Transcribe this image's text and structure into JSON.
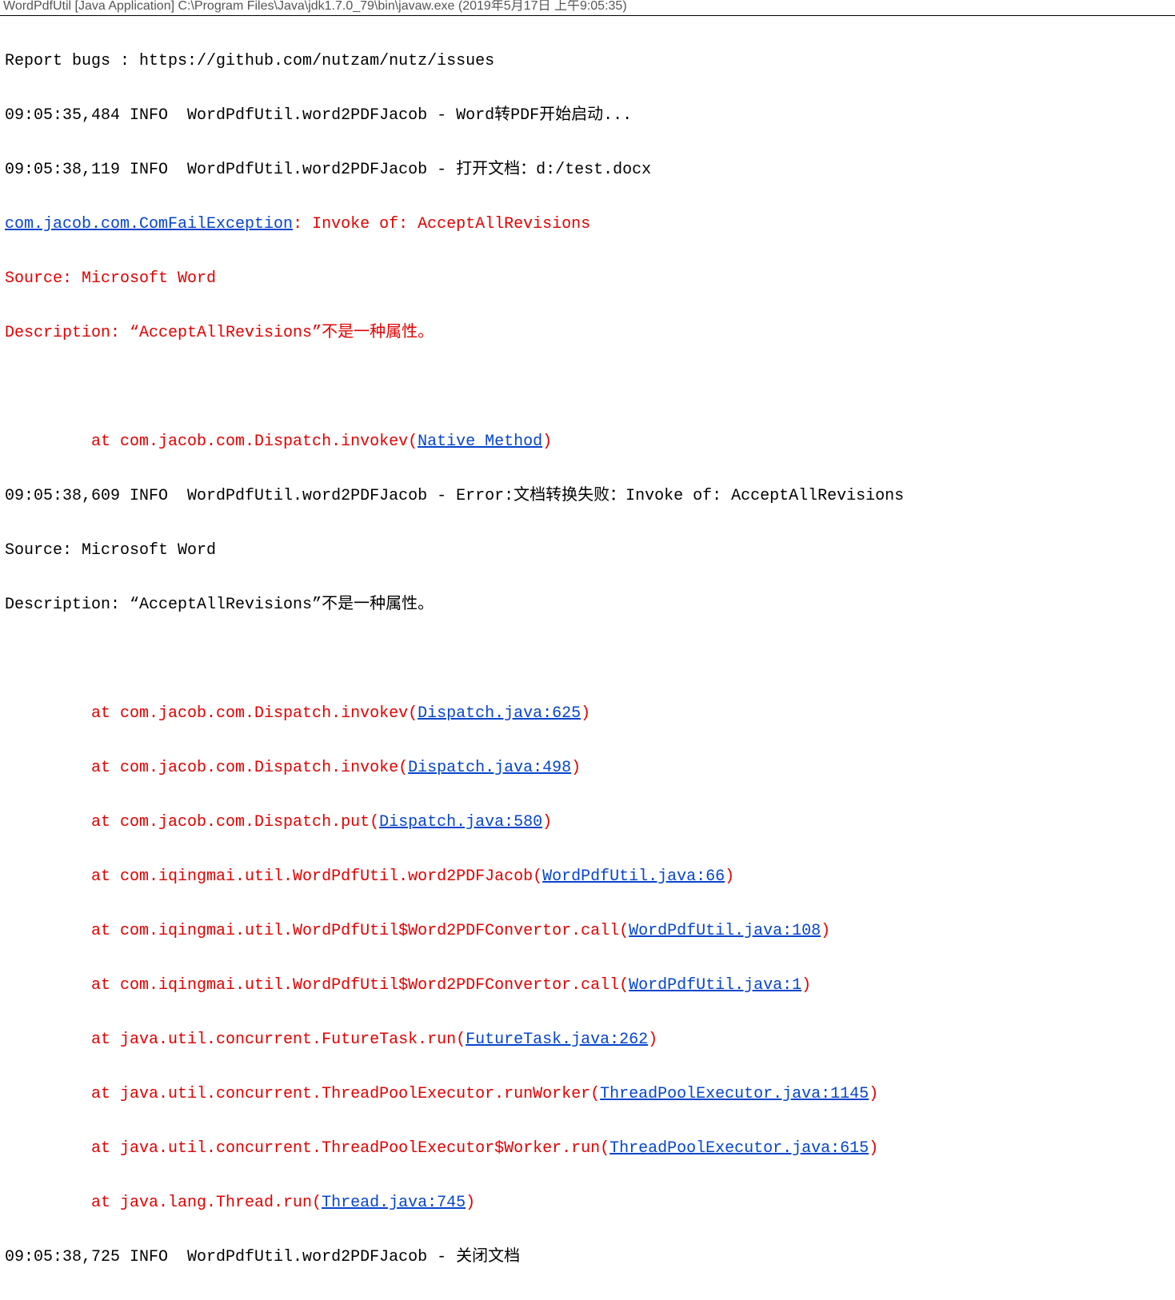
{
  "titlebar": "WordPdfUtil [Java Application] C:\\Program Files\\Java\\jdk1.7.0_79\\bin\\javaw.exe (2019年5月17日 上午9:05:35)",
  "lines": {
    "l01": "Report bugs : https://github.com/nutzam/nutz/issues",
    "l02": "09:05:35,484 INFO  WordPdfUtil.word2PDFJacob - Word转PDF开始启动...",
    "l03": "09:05:38,119 INFO  WordPdfUtil.word2PDFJacob - 打开文档：d:/test.docx",
    "l04a": "com.jacob.com.ComFailException",
    "l04b": ": Invoke of: AcceptAllRevisions",
    "l05": "Source: Microsoft Word",
    "l06": "Description: “AcceptAllRevisions”不是一种属性。",
    "l07a": "at com.jacob.com.Dispatch.invokev(",
    "l07b": "Native Method",
    "l07c": ")",
    "l08": "09:05:38,609 INFO  WordPdfUtil.word2PDFJacob - Error:文档转换失败：Invoke of: AcceptAllRevisions",
    "l09": "Source: Microsoft Word",
    "l10": "Description: “AcceptAllRevisions”不是一种属性。",
    "st1a": "at com.jacob.com.Dispatch.invokev(",
    "st1b": "Dispatch.java:625",
    "st1c": ")",
    "st2a": "at com.jacob.com.Dispatch.invoke(",
    "st2b": "Dispatch.java:498",
    "st2c": ")",
    "st3a": "at com.jacob.com.Dispatch.put(",
    "st3b": "Dispatch.java:580",
    "st3c": ")",
    "st4a": "at com.iqingmai.util.WordPdfUtil.word2PDFJacob(",
    "st4b": "WordPdfUtil.java:66",
    "st4c": ")",
    "st5a": "at com.iqingmai.util.WordPdfUtil$Word2PDFConvertor.call(",
    "st5b": "WordPdfUtil.java:108",
    "st5c": ")",
    "st6a": "at com.iqingmai.util.WordPdfUtil$Word2PDFConvertor.call(",
    "st6b": "WordPdfUtil.java:1",
    "st6c": ")",
    "st7a": "at java.util.concurrent.FutureTask.run(",
    "st7b": "FutureTask.java:262",
    "st7c": ")",
    "st8a": "at java.util.concurrent.ThreadPoolExecutor.runWorker(",
    "st8b": "ThreadPoolExecutor.java:1145",
    "st8c": ")",
    "st9a": "at java.util.concurrent.ThreadPoolExecutor$Worker.run(",
    "st9b": "ThreadPoolExecutor.java:615",
    "st9c": ")",
    "st10a": "at java.lang.Thread.run(",
    "st10b": "Thread.java:745",
    "st10c": ")",
    "l_end": "09:05:38,725 INFO  WordPdfUtil.word2PDFJacob - 关闭文档"
  }
}
